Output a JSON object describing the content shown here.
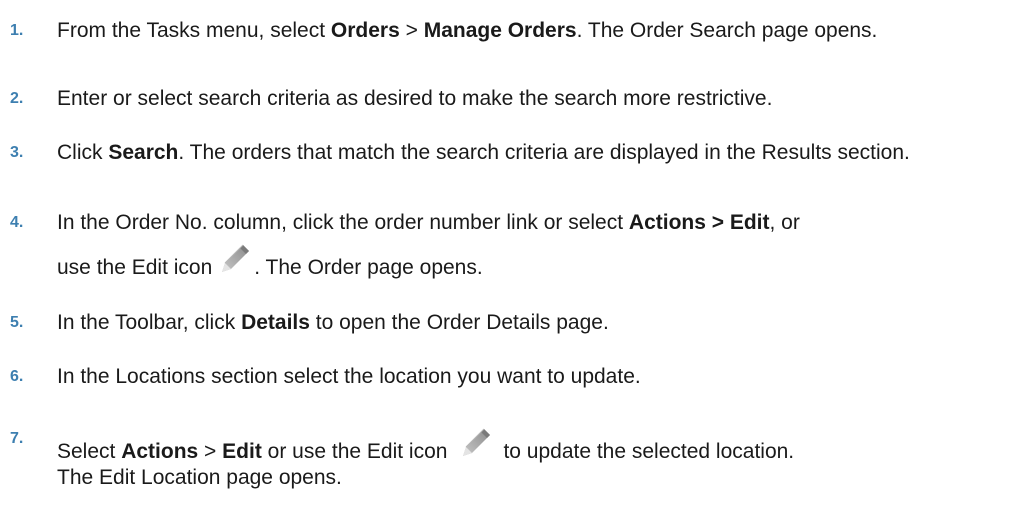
{
  "steps": [
    {
      "number": "1.",
      "parts": {
        "a": "From the Tasks menu, select ",
        "b": "Orders",
        "c": " > ",
        "d": "Manage Orders",
        "e": ". The Order Search page opens."
      }
    },
    {
      "number": "2.",
      "parts": {
        "a": "Enter or select search criteria as desired to make the search more restrictive."
      }
    },
    {
      "number": "3.",
      "parts": {
        "a": "Click ",
        "b": "Search",
        "c": ". The orders that match the search criteria are displayed in the Results section."
      }
    },
    {
      "number": "4.",
      "parts": {
        "a": "In the Order No. column, click the order number link or select ",
        "b": "Actions > Edit",
        "c": ", or",
        "d": "use the Edit icon",
        "e": ". The Order page opens."
      },
      "icon": "pencil-icon"
    },
    {
      "number": "5.",
      "parts": {
        "a": "In the Toolbar, click ",
        "b": "Details",
        "c": " to open the Order Details page."
      }
    },
    {
      "number": "6.",
      "parts": {
        "a": "In the Locations section select the location you want to update."
      }
    },
    {
      "number": "7.",
      "parts": {
        "a": "Select ",
        "b": "Actions",
        "c": " > ",
        "d": "Edit",
        "e": " or use the Edit icon",
        "f": "to update the selected location.",
        "g": "The Edit Location page opens."
      },
      "icon": "pencil-icon"
    }
  ],
  "colors": {
    "step_number": "#3d7fb0",
    "body_text": "#1a1a1a"
  }
}
